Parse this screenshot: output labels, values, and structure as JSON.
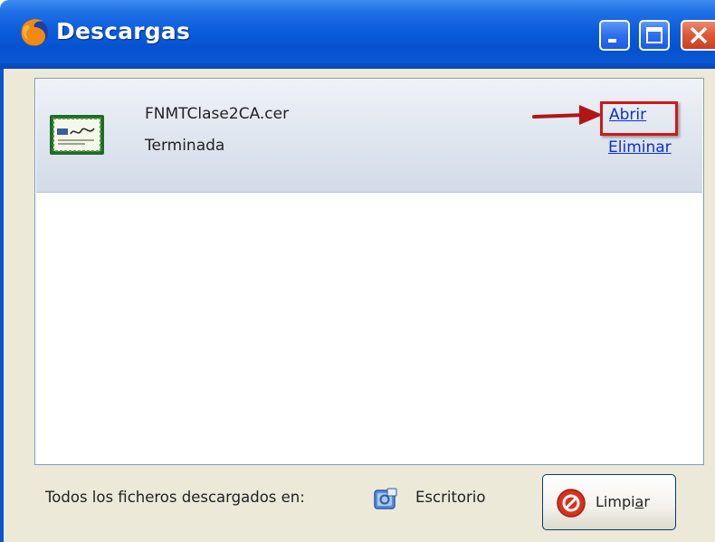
{
  "window": {
    "title": "Descargas"
  },
  "download_item": {
    "file_name": "FNMTClase2CA.cer",
    "status": "Terminada",
    "open_label": "Abrir",
    "remove_label": "Eliminar"
  },
  "footer": {
    "location_label": "Todos los ficheros descargados en:",
    "folder_name": "Escritorio",
    "clear_label_pre": "Limpi",
    "clear_label_underlined": "a",
    "clear_label_post": "r"
  },
  "annotation": {
    "highlight_color": "#d01818"
  },
  "icons": {
    "app": "firefox-icon",
    "file": "certificate-icon",
    "folder": "desktop-folder-icon",
    "clear": "clear-stop-icon"
  }
}
